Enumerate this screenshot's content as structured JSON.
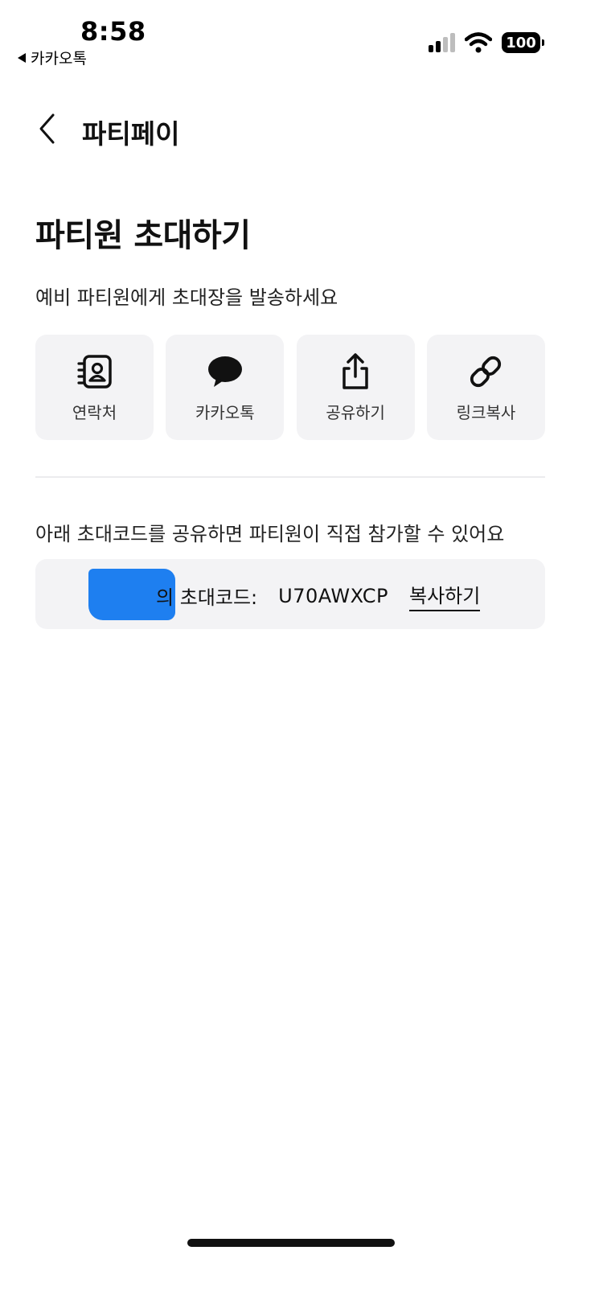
{
  "status_bar": {
    "time": "8:58",
    "back_app_label": "카카오톡",
    "battery": "100"
  },
  "header": {
    "title": "파티페이"
  },
  "main": {
    "title": "파티원 초대하기",
    "subtitle": "예비 파티원에게 초대장을 발송하세요",
    "share_options": [
      {
        "label": "연락처",
        "icon": "contacts-icon"
      },
      {
        "label": "카카오톡",
        "icon": "chat-bubble-icon"
      },
      {
        "label": "공유하기",
        "icon": "share-icon"
      },
      {
        "label": "링크복사",
        "icon": "link-icon"
      }
    ],
    "code_hint": "아래 초대코드를 공유하면 파티원이 직접 참가할 수 있어요",
    "invite": {
      "owner_suffix": "의 초대코드:",
      "code": "U70AWXCP",
      "copy_label": "복사하기"
    }
  },
  "colors": {
    "card_background": "#f3f3f5",
    "redaction": "#1e7ff0",
    "text_primary": "#111111"
  }
}
